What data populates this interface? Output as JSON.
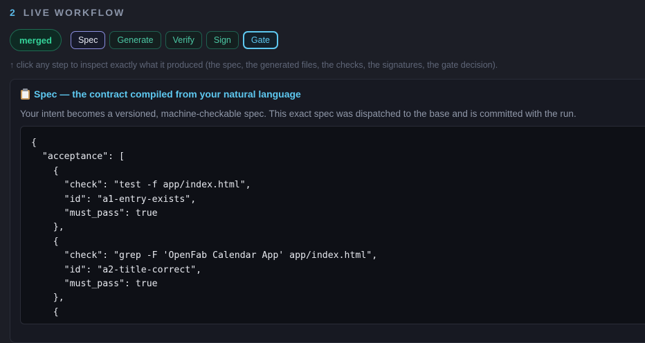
{
  "section": {
    "number": "2",
    "title": "LIVE WORKFLOW"
  },
  "status": {
    "label": "merged",
    "color": "#34d399"
  },
  "steps": [
    {
      "label": "Spec",
      "state": "selected"
    },
    {
      "label": "Generate",
      "state": "default"
    },
    {
      "label": "Verify",
      "state": "default"
    },
    {
      "label": "Sign",
      "state": "default"
    },
    {
      "label": "Gate",
      "state": "focused"
    }
  ],
  "hint": "↑ click any step to inspect exactly what it produced (the spec, the generated files, the checks, the signatures, the gate decision).",
  "panel": {
    "icon": "clipboard-icon",
    "title": "Spec — the contract compiled from your natural language",
    "description": "Your intent becomes a versioned, machine-checkable spec. This exact spec was dispatched to the base and is committed with the run.",
    "code": "{\n  \"acceptance\": [\n    {\n      \"check\": \"test -f app/index.html\",\n      \"id\": \"a1-entry-exists\",\n      \"must_pass\": true\n    },\n    {\n      \"check\": \"grep -F 'OpenFab Calendar App' app/index.html\",\n      \"id\": \"a2-title-correct\",\n      \"must_pass\": true\n    },\n    {"
  },
  "colors": {
    "accent": "#5ec8f0",
    "step_border": "#1f6050",
    "step_text": "#4cc7a4",
    "background": "#1c1e26"
  }
}
